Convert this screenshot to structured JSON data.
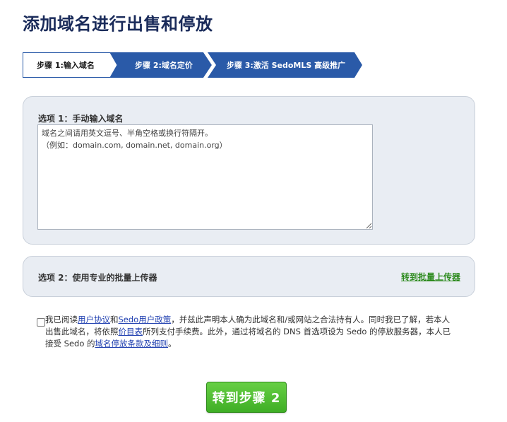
{
  "page": {
    "title": "添加域名进行出售和停放"
  },
  "steps": [
    {
      "label": "步骤 1:输入域名",
      "active": true
    },
    {
      "label": "步骤 2:域名定价",
      "active": false
    },
    {
      "label": "步骤 3:激活 SedoMLS 高级推广",
      "active": false
    }
  ],
  "colors": {
    "step_blue": "#2a5aa8",
    "title_navy": "#1a2b5a",
    "panel_bg": "#e9edf3",
    "link_green": "#2e8b1f",
    "button_green": "#48b82c",
    "link_blue": "#1f3fb0"
  },
  "option1": {
    "label": "选项 1：手动输入域名",
    "textarea_line1": "域名之间请用英文逗号、半角空格或换行符隔开。",
    "textarea_line2": "（例如：domain.com, domain.net, domain.org）"
  },
  "option2": {
    "label": "选项 2：使用专业的批量上传器",
    "link": "转到批量上传器"
  },
  "agreement": {
    "checked": false,
    "t1": "我已阅读",
    "link_user_agreement": "用户协议",
    "t2": "和",
    "link_privacy": "Sedo用户政策",
    "t3": "，并兹此声明本人确为此域名和/或网站之合法持有人。同时我已了解，若本人出售此域名，将依照",
    "link_price_list": "价目表",
    "t4": "所列支付手续费。此外，通过将域名的 DNS 首选项设为 Sedo 的停放服务器，本人已接受 Sedo 的",
    "link_parking_terms": "域名停放条款及细则",
    "t5": "。"
  },
  "submit": {
    "label": "转到步骤 2"
  }
}
